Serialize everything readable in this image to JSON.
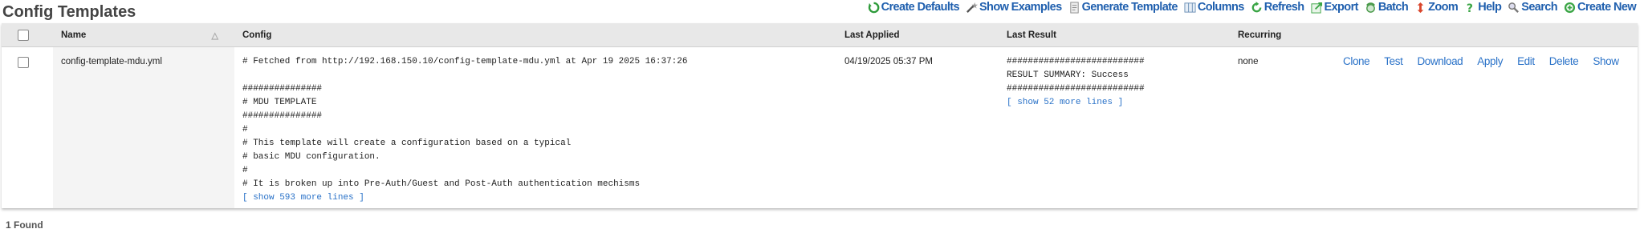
{
  "page": {
    "title": "Config Templates"
  },
  "toolbar": {
    "items": [
      {
        "label": "Create Defaults",
        "icon": "create-defaults-icon",
        "color": "#2e9b3a"
      },
      {
        "label": "Show Examples",
        "icon": "magic-wand-icon",
        "color": "#555555"
      },
      {
        "label": "Generate Template",
        "icon": "document-icon",
        "color": "#888888"
      },
      {
        "label": "Columns",
        "icon": "columns-icon",
        "color": "#6b8fb5"
      },
      {
        "label": "Refresh",
        "icon": "refresh-icon",
        "color": "#3aa545"
      },
      {
        "label": "Export",
        "icon": "export-icon",
        "color": "#3aa545"
      },
      {
        "label": "Batch",
        "icon": "batch-icon",
        "color": "#4a9a4a"
      },
      {
        "label": "Zoom",
        "icon": "zoom-arrows-icon",
        "color": "#d9442a"
      },
      {
        "label": "Help",
        "icon": "help-icon",
        "color": "#3aa545"
      },
      {
        "label": "Search",
        "icon": "search-icon",
        "color": "#777777"
      },
      {
        "label": "Create New",
        "icon": "plus-circle-icon",
        "color": "#3aa545"
      }
    ]
  },
  "table": {
    "headers": {
      "name": "Name",
      "config": "Config",
      "last_applied": "Last Applied",
      "last_result": "Last Result",
      "recurring": "Recurring"
    },
    "rows": [
      {
        "name": "config-template-mdu.yml",
        "config_text": "# Fetched from http://192.168.150.10/config-template-mdu.yml at Apr 19 2025 16:37:26\n\n###############\n# MDU TEMPLATE\n###############\n#\n# This template will create a configuration based on a typical\n# basic MDU configuration.\n#\n# It is broken up into Pre-Auth/Guest and Post-Auth authentication mechisms",
        "config_more": "[ show 593 more lines ]",
        "last_applied": "04/19/2025 05:37 PM",
        "result_text": "##########################\nRESULT SUMMARY: Success\n##########################",
        "result_more": "[ show 52 more lines ]",
        "recurring": "none",
        "actions": [
          "Clone",
          "Test",
          "Download",
          "Apply",
          "Edit",
          "Delete",
          "Show"
        ]
      }
    ]
  },
  "footer": {
    "count": "1 Found"
  }
}
